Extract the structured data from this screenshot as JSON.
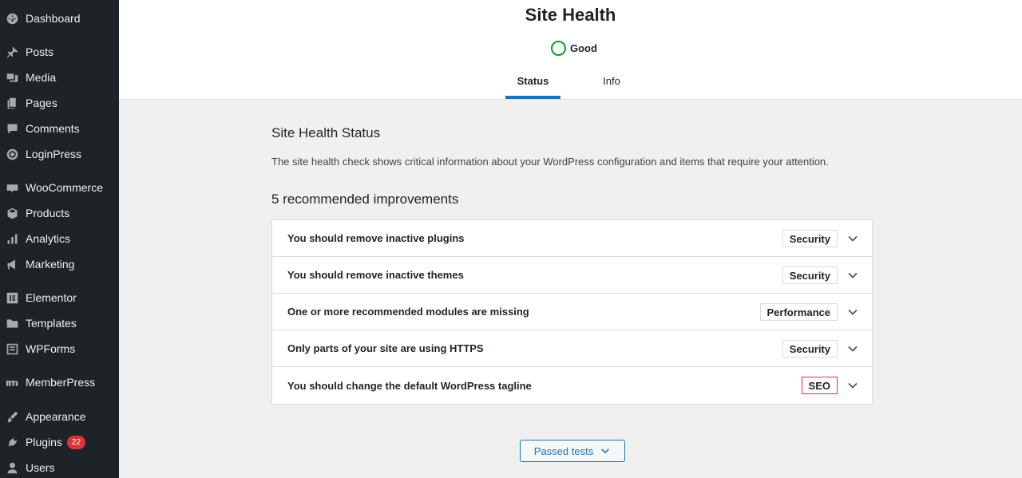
{
  "sidebar": {
    "items": [
      {
        "label": "Dashboard",
        "icon": "dashboard-icon"
      },
      {
        "label": "Posts",
        "icon": "pin-icon"
      },
      {
        "label": "Media",
        "icon": "media-icon"
      },
      {
        "label": "Pages",
        "icon": "pages-icon"
      },
      {
        "label": "Comments",
        "icon": "comment-icon"
      },
      {
        "label": "LoginPress",
        "icon": "loginpress-icon"
      },
      {
        "label": "WooCommerce",
        "icon": "woo-icon"
      },
      {
        "label": "Products",
        "icon": "box-icon"
      },
      {
        "label": "Analytics",
        "icon": "bar-chart-icon"
      },
      {
        "label": "Marketing",
        "icon": "megaphone-icon"
      },
      {
        "label": "Elementor",
        "icon": "elementor-icon"
      },
      {
        "label": "Templates",
        "icon": "folder-icon"
      },
      {
        "label": "WPForms",
        "icon": "form-icon"
      },
      {
        "label": "MemberPress",
        "icon": "memberpress-icon"
      },
      {
        "label": "Appearance",
        "icon": "brush-icon"
      },
      {
        "label": "Plugins",
        "icon": "plug-icon",
        "badge": "22"
      },
      {
        "label": "Users",
        "icon": "user-icon"
      }
    ]
  },
  "header": {
    "title": "Site Health",
    "score": "Good",
    "tabs": [
      {
        "label": "Status",
        "active": true
      },
      {
        "label": "Info",
        "active": false
      }
    ]
  },
  "main": {
    "section_title": "Site Health Status",
    "description": "The site health check shows critical information about your WordPress configuration and items that require your attention.",
    "count_label": "5 recommended improvements",
    "issues": [
      {
        "text": "You should remove inactive plugins",
        "tag": "Security"
      },
      {
        "text": "You should remove inactive themes",
        "tag": "Security"
      },
      {
        "text": "One or more recommended modules are missing",
        "tag": "Performance"
      },
      {
        "text": "Only parts of your site are using HTTPS",
        "tag": "Security"
      },
      {
        "text": "You should change the default WordPress tagline",
        "tag": "SEO"
      }
    ],
    "passed_button": "Passed tests"
  },
  "colors": {
    "sidebar_bg": "#1d2327",
    "accent": "#2271b1",
    "good": "#00a32a",
    "highlight": "#d63638"
  }
}
